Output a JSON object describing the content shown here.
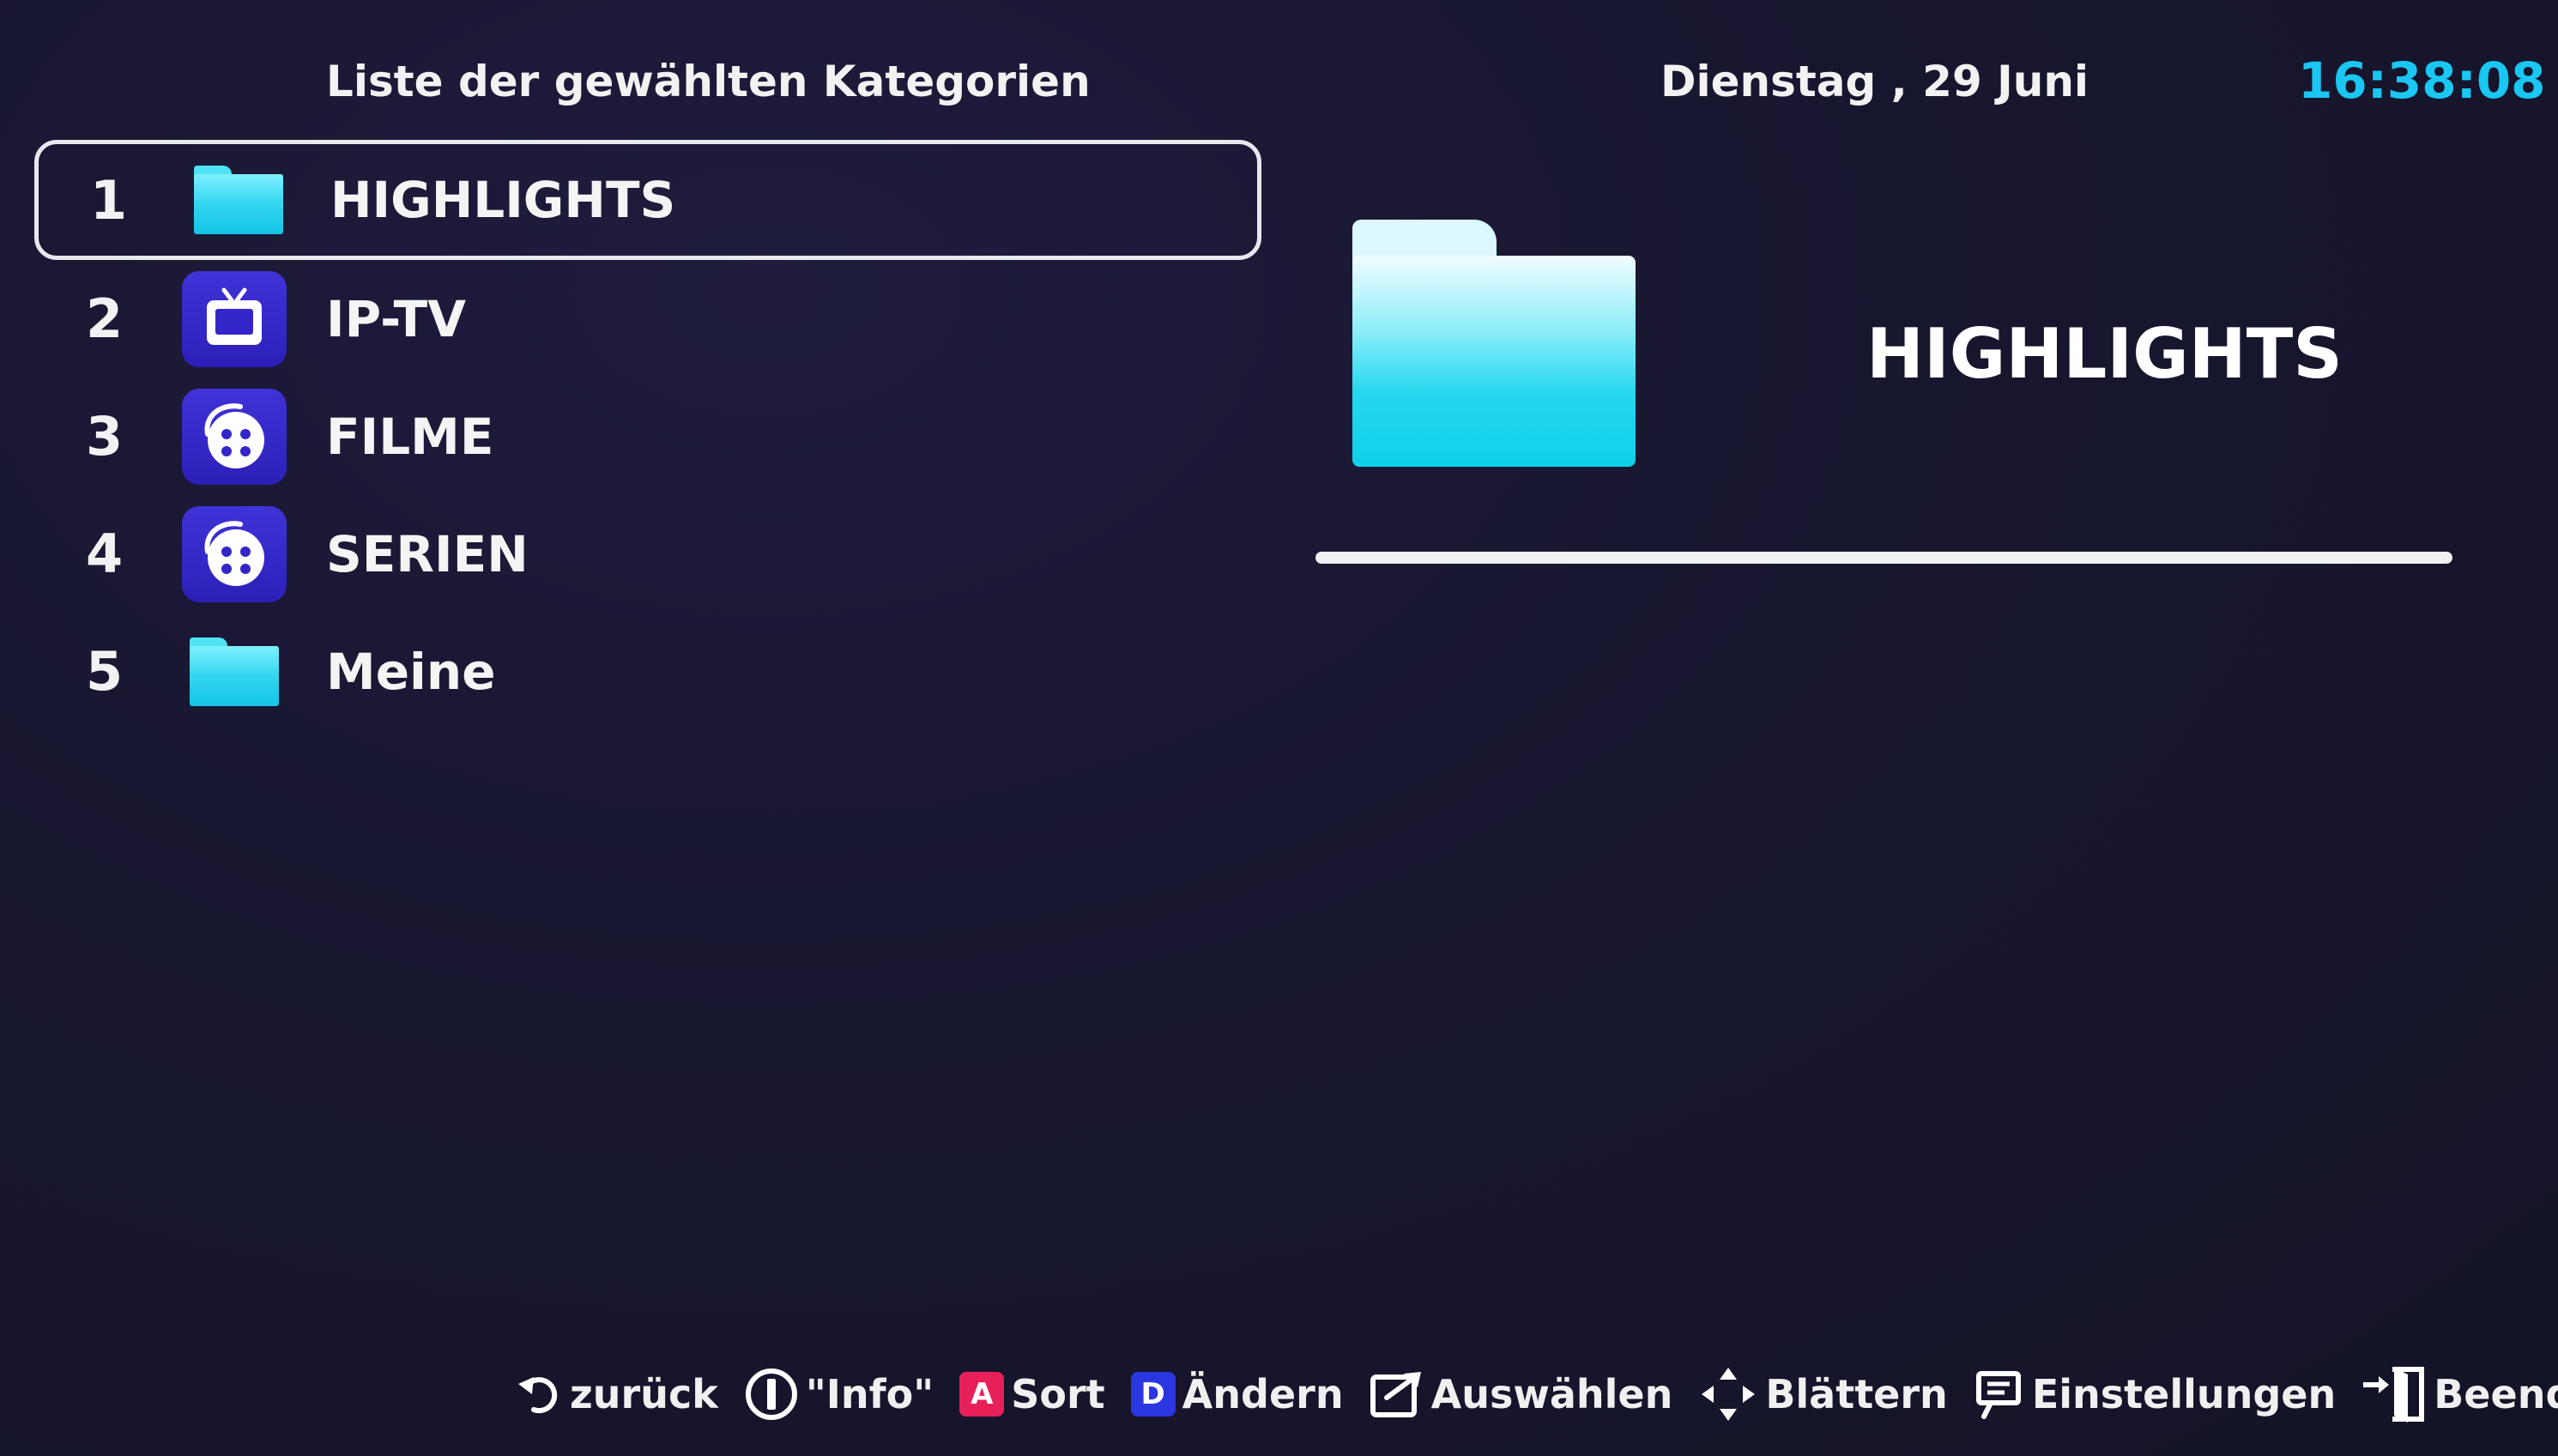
{
  "header": {
    "title": "Liste der gewählten Kategorien",
    "date": "Dienstag , 29 Juni",
    "clock": "16:38:08"
  },
  "categories": [
    {
      "number": "1",
      "label": "HIGHLIGHTS",
      "icon": "folder-icon",
      "selected": true
    },
    {
      "number": "2",
      "label": "IP-TV",
      "icon": "tv-icon",
      "selected": false
    },
    {
      "number": "3",
      "label": "FILME",
      "icon": "film-reel-icon",
      "selected": false
    },
    {
      "number": "4",
      "label": "SERIEN",
      "icon": "film-reel-icon",
      "selected": false
    },
    {
      "number": "5",
      "label": "Meine",
      "icon": "folder-icon",
      "selected": false
    }
  ],
  "detail": {
    "title": "HIGHLIGHTS",
    "icon": "folder-icon"
  },
  "footer": {
    "hints": [
      {
        "icon": "back-arrow-icon",
        "label": "zurück"
      },
      {
        "icon": "info-icon",
        "label": "\"Info\""
      },
      {
        "icon": "red-a-key-icon",
        "key": "A",
        "label": "Sort"
      },
      {
        "icon": "blue-d-key-icon",
        "key": "D",
        "label": "Ändern"
      },
      {
        "icon": "select-icon",
        "label": "Auswählen"
      },
      {
        "icon": "navigate-arrows-icon",
        "label": "Blättern"
      },
      {
        "icon": "settings-icon",
        "label": "Einstellungen"
      },
      {
        "icon": "exit-door-icon",
        "label": "Beenden"
      }
    ]
  },
  "colors": {
    "background": "#15142a",
    "clock": "#19c7f2",
    "folder": "#1fcde9",
    "app_icon": "#3326c8",
    "key_red": "#e8205a",
    "key_blue": "#2a36e0"
  }
}
